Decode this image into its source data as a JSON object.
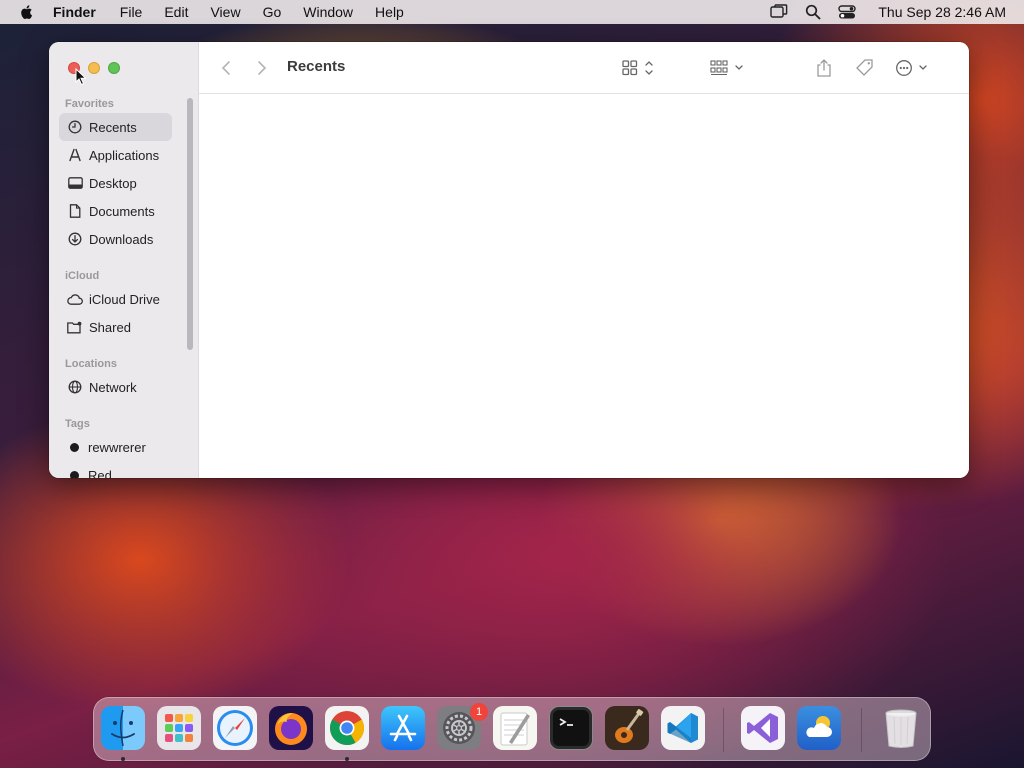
{
  "menubar": {
    "app_name": "Finder",
    "menus": [
      "File",
      "Edit",
      "View",
      "Go",
      "Window",
      "Help"
    ],
    "clock": "Thu Sep 28  2:46 AM"
  },
  "finder": {
    "title": "Recents",
    "sections": {
      "favorites": "Favorites",
      "icloud": "iCloud",
      "locations": "Locations",
      "tags": "Tags"
    },
    "favorites": [
      {
        "label": "Recents",
        "icon": "clock-icon",
        "selected": true
      },
      {
        "label": "Applications",
        "icon": "applications-icon"
      },
      {
        "label": "Desktop",
        "icon": "desktop-icon"
      },
      {
        "label": "Documents",
        "icon": "document-icon"
      },
      {
        "label": "Downloads",
        "icon": "download-icon"
      }
    ],
    "icloud": [
      {
        "label": "iCloud Drive",
        "icon": "cloud-icon"
      },
      {
        "label": "Shared",
        "icon": "shared-folder-icon"
      }
    ],
    "locations": [
      {
        "label": "Network",
        "icon": "globe-icon"
      }
    ],
    "tags": [
      {
        "label": "rewwrerer",
        "color": "#1b1b1b"
      },
      {
        "label": "Red",
        "color": "#1b1b1b"
      }
    ]
  },
  "dock": {
    "apps": [
      {
        "name": "finder-icon",
        "running": true
      },
      {
        "name": "launchpad-icon",
        "running": false
      },
      {
        "name": "safari-icon",
        "running": false
      },
      {
        "name": "firefox-icon",
        "running": false
      },
      {
        "name": "chrome-icon",
        "running": true
      },
      {
        "name": "app-store-icon",
        "running": false
      },
      {
        "name": "system-settings-icon",
        "running": false,
        "badge": "1"
      },
      {
        "name": "textedit-icon",
        "running": false
      },
      {
        "name": "terminal-icon",
        "running": false
      },
      {
        "name": "garageband-icon",
        "running": false
      },
      {
        "name": "vscode-icon",
        "running": false
      },
      {
        "name": "visual-studio-icon",
        "running": false
      },
      {
        "name": "weather-icon",
        "running": false
      },
      {
        "name": "trash-icon",
        "running": false
      }
    ]
  }
}
